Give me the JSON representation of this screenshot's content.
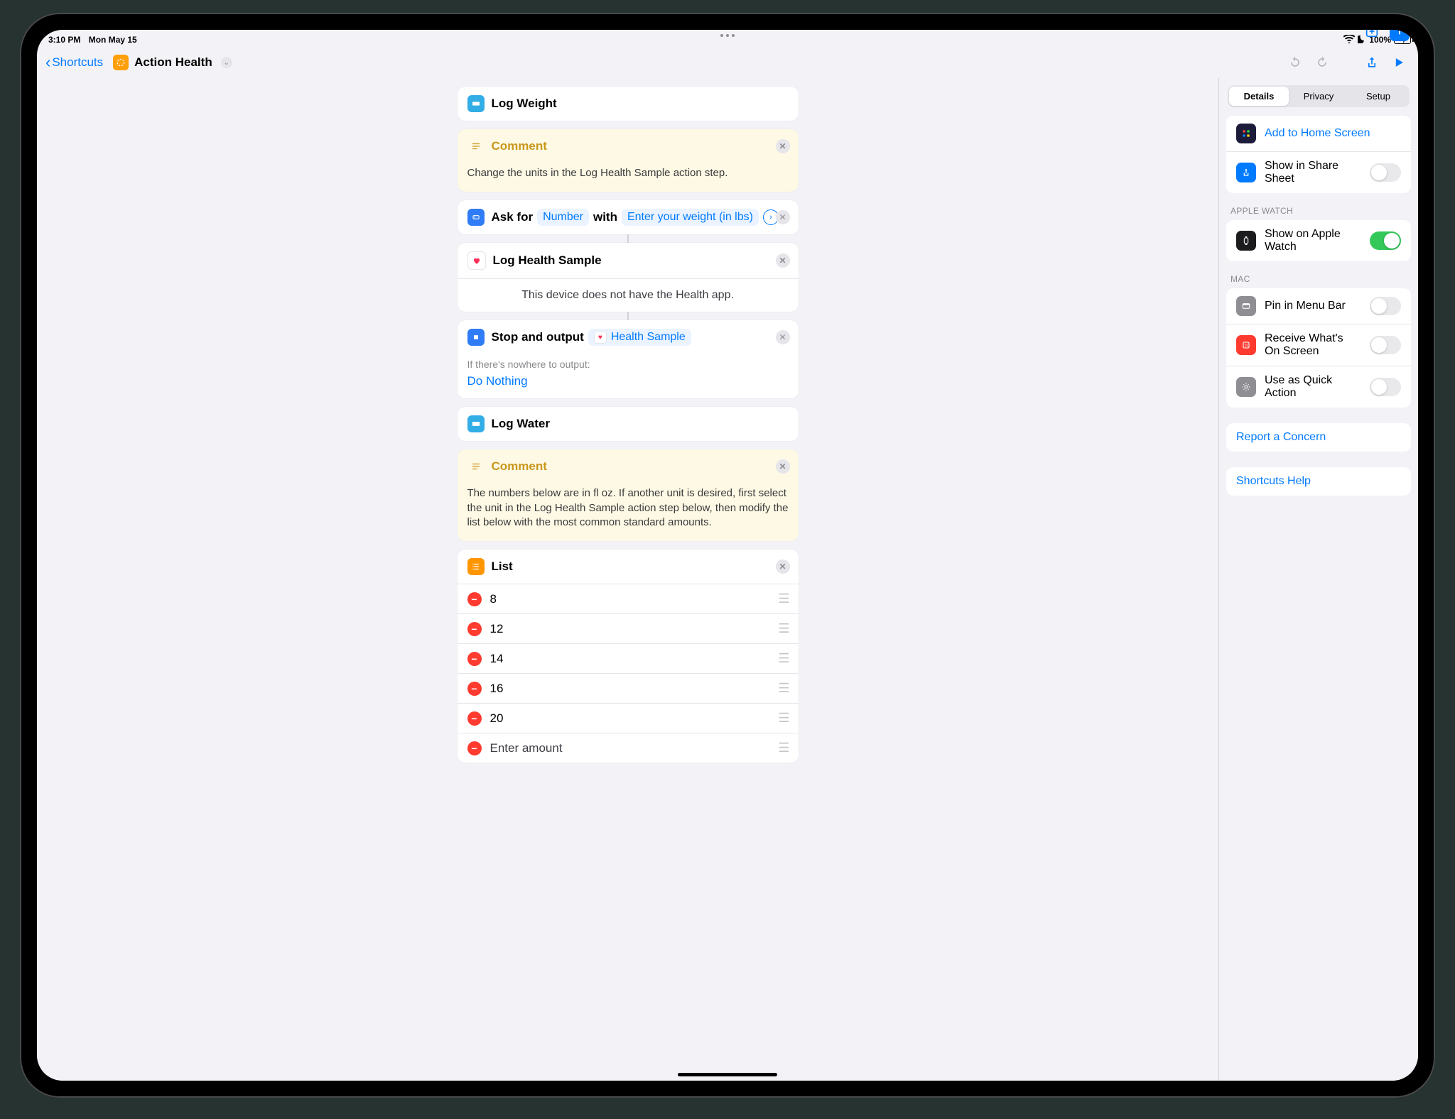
{
  "status": {
    "time": "3:10 PM",
    "date": "Mon May 15",
    "battery_text": "100%"
  },
  "header": {
    "back": "Shortcuts",
    "title": "Action Health"
  },
  "actions": {
    "log_weight_title": "Log Weight",
    "comment1": {
      "title": "Comment",
      "body": "Change the units in the Log Health Sample action step."
    },
    "ask": {
      "prefix": "Ask for",
      "type": "Number",
      "with": "with",
      "prompt": "Enter your weight (in lbs)"
    },
    "loghealth": {
      "title": "Log Health Sample",
      "msg": "This device does not have the Health app."
    },
    "stop": {
      "prefix": "Stop and output",
      "pill": "Health Sample",
      "sub": "If there's nowhere to output:",
      "link": "Do Nothing"
    },
    "log_water_title": "Log Water",
    "comment2": {
      "title": "Comment",
      "body": "The numbers below are in fl oz. If another unit is desired, first select the unit in the Log Health Sample action step below, then modify the list below with the most common standard amounts."
    },
    "list": {
      "title": "List",
      "items": [
        "8",
        "12",
        "14",
        "16",
        "20",
        "Enter amount"
      ]
    }
  },
  "sidebar": {
    "tabs": [
      "Details",
      "Privacy",
      "Setup"
    ],
    "top": {
      "add_home": "Add to Home Screen",
      "share_sheet": "Show in Share Sheet"
    },
    "watch_label": "APPLE WATCH",
    "watch": "Show on Apple Watch",
    "mac_label": "MAC",
    "mac": {
      "pin": "Pin in Menu Bar",
      "receive": "Receive What's On Screen",
      "quick": "Use as Quick Action"
    },
    "report": "Report a Concern",
    "help": "Shortcuts Help"
  }
}
